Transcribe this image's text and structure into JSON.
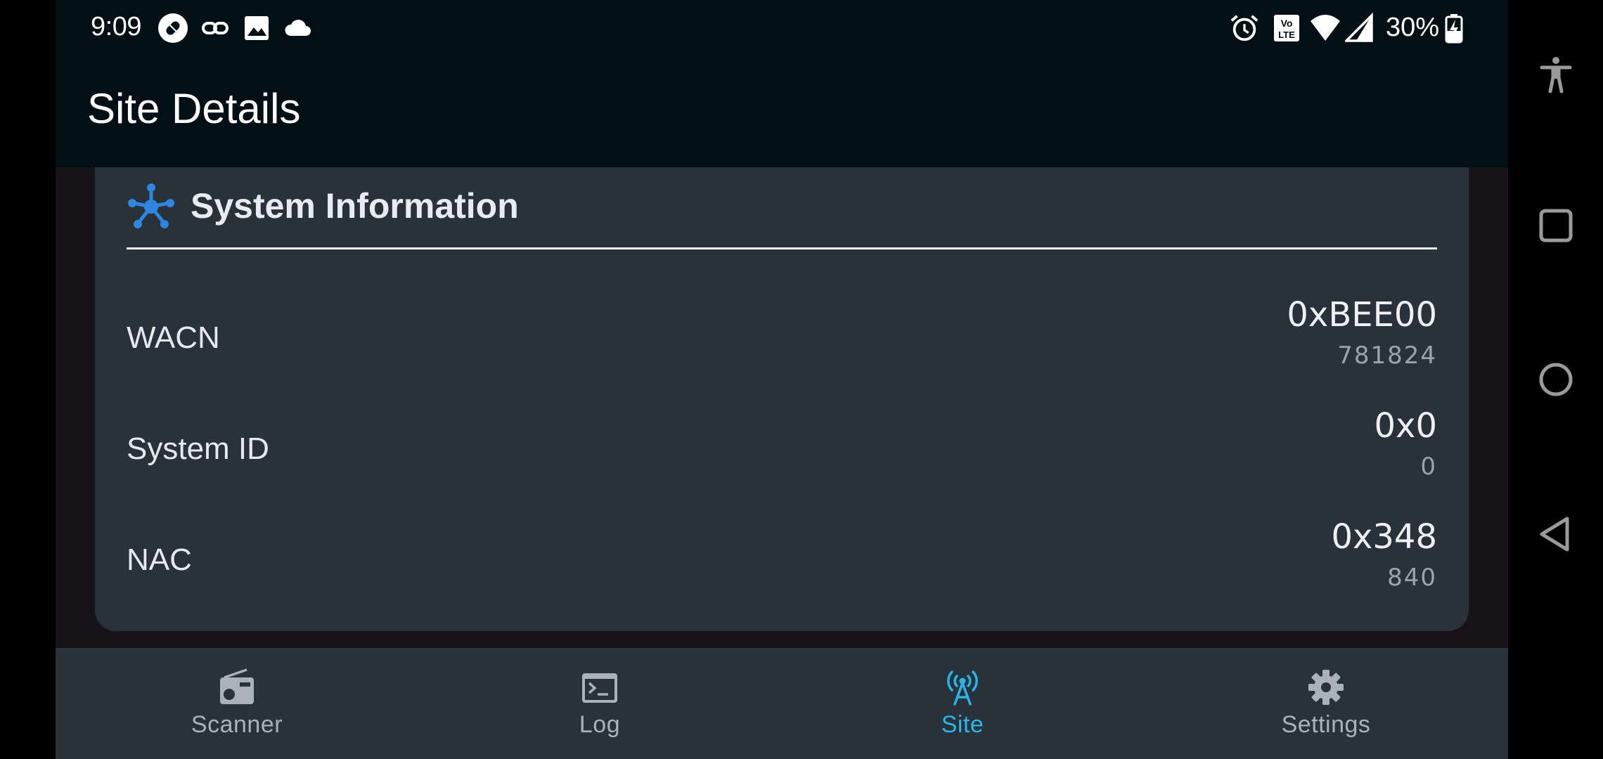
{
  "status_bar": {
    "time": "9:09",
    "battery_percent": "30%",
    "left_icons": [
      "pill-notification-icon",
      "link-icon",
      "image-icon",
      "cloud-icon"
    ],
    "right_icons": [
      "alarm-icon",
      "volte-icon",
      "wifi-icon",
      "cell-signal-icon",
      "battery-charging-icon"
    ]
  },
  "app_bar": {
    "title": "Site Details"
  },
  "card": {
    "title": "System Information",
    "icon": "network-hub-icon",
    "accent_color": "#2f86e0",
    "rows": [
      {
        "label": "WACN",
        "hex": "0xBEE00",
        "decimal": "781824"
      },
      {
        "label": "System ID",
        "hex": "0x0",
        "decimal": "0"
      },
      {
        "label": "NAC",
        "hex": "0x348",
        "decimal": "840"
      }
    ]
  },
  "bottom_nav": {
    "active_color": "#29b6e6",
    "items": [
      {
        "label": "Scanner",
        "icon": "radio-icon",
        "active": false
      },
      {
        "label": "Log",
        "icon": "terminal-icon",
        "active": false
      },
      {
        "label": "Site",
        "icon": "antenna-tower-icon",
        "active": true
      },
      {
        "label": "Settings",
        "icon": "gear-icon",
        "active": false
      }
    ]
  },
  "system_nav": {
    "buttons": [
      "accessibility-icon",
      "recents-icon",
      "home-icon",
      "back-icon"
    ]
  }
}
